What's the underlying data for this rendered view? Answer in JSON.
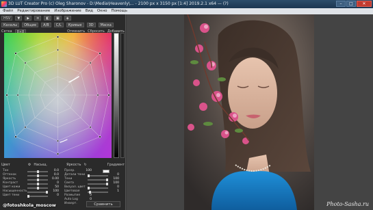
{
  "window": {
    "title": "3D LUT Creator Pro (c) Oleg Sharonov - D:\\Media\\Heavenly\\... - 2100 px x 3150 px [1:4] 2019.2.1 x64 — (?)",
    "min_label": "–",
    "max_label": "□",
    "close_label": "✕"
  },
  "menu": [
    "Файл",
    "Редактирование",
    "Изображение",
    "Вид",
    "Окно",
    "Помощь"
  ],
  "toolbar1": {
    "mode": "HSV",
    "items": [
      "▼",
      "▶",
      "≡",
      "◧",
      "▣",
      "◈"
    ]
  },
  "toolbar2": {
    "items": [
      "Каналы",
      "Общие",
      "A/B",
      "C/L",
      "Кривые",
      "3D",
      "Маска"
    ]
  },
  "toolbar3": {
    "grid_label": "Сетка",
    "grid_size": "8×8",
    "undo": "Отменить",
    "redo": "Сбросить",
    "extra": "Добавить"
  },
  "under_grid": {
    "left": "Цвет",
    "mid": "Насыщ.",
    "right": "Яркость",
    "far_right": "Градиент"
  },
  "left_controls": [
    {
      "label": "Тон",
      "value": "0.0"
    },
    {
      "label": "Оттенок",
      "value": "0.0"
    },
    {
      "label": "Яркость",
      "value": "0.00"
    },
    {
      "label": "Контраст",
      "value": "0"
    },
    {
      "label": "Цвет кожи",
      "value": "50"
    },
    {
      "label": "Насыщенность",
      "value": "100"
    },
    {
      "label": "Цвет тени",
      "value": "0"
    }
  ],
  "right_controls": [
    {
      "label": "Прозр.",
      "value": "100"
    },
    {
      "label": "Детали тени",
      "value": "0"
    },
    {
      "label": "Тени",
      "value": "100"
    },
    {
      "label": "Света",
      "value": "100"
    },
    {
      "label": "Визуал. цвет",
      "value": "0"
    },
    {
      "label": "Цветовая",
      "value": "1"
    },
    {
      "label": "Размытие",
      "value": "0"
    },
    {
      "label": "Auto Log",
      "value": "0"
    },
    {
      "label": "Инверт.",
      "value": "—"
    }
  ],
  "bottom": {
    "compare_label": "Сравнить"
  },
  "overlay": {
    "instagram": "@fotoshkola_moscow",
    "watermark": "Photo-Sasha.ru"
  },
  "colors": {
    "accent": "#2c4d6a",
    "panel_bg": "#2a2a2a",
    "viewer_bg": "#444444"
  }
}
